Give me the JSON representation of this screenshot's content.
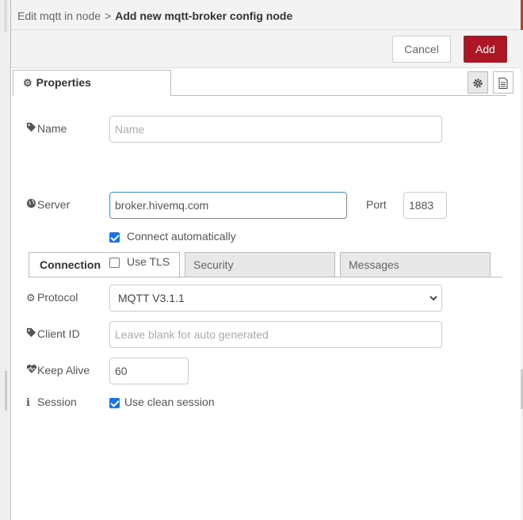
{
  "breadcrumb": {
    "parent": "Edit mqtt in node",
    "separator": ">",
    "current": "Add new mqtt-broker config node"
  },
  "toolbar": {
    "cancel_label": "Cancel",
    "add_label": "Add"
  },
  "tabs": {
    "properties_label": "Properties"
  },
  "form": {
    "name_label": "Name",
    "name_placeholder": "Name",
    "inner_tabs": [
      "Connection",
      "Security",
      "Messages"
    ],
    "server_label": "Server",
    "server_value": "broker.hivemq.com",
    "port_label": "Port",
    "port_value": "1883",
    "connect_auto_label": "Connect automatically",
    "connect_auto_checked": true,
    "use_tls_label": "Use TLS",
    "use_tls_checked": false,
    "protocol_label": "Protocol",
    "protocol_value": "MQTT V3.1.1",
    "client_id_label": "Client ID",
    "client_id_placeholder": "Leave blank for auto generated",
    "keep_alive_label": "Keep Alive",
    "keep_alive_value": "60",
    "session_label": "Session",
    "clean_session_label": "Use clean session",
    "clean_session_checked": true
  },
  "colors": {
    "accent_red": "#ad1625",
    "checkbox_blue": "#1a73e8",
    "focus_blue": "#4a90d9"
  },
  "icons": [
    "gear-icon",
    "document-icon",
    "tag-icon",
    "globe-icon",
    "heartbeat-icon",
    "info-icon",
    "chevron-down-icon"
  ]
}
